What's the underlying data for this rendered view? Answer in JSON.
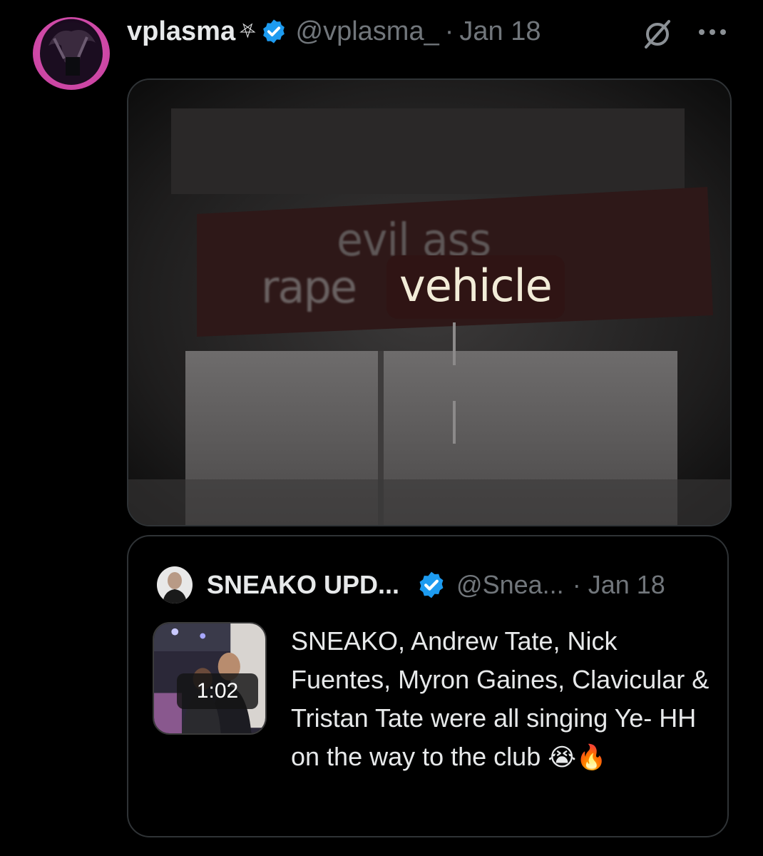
{
  "post": {
    "display_name": "vplasma",
    "name_symbol": "⛧",
    "handle": "@vplasma_",
    "separator": "·",
    "date": "Jan 18",
    "more": "···"
  },
  "media": {
    "caption_top": "evil ass",
    "caption_left": "rape",
    "caption_highlight": "vehicle"
  },
  "quote": {
    "display_name": "SNEAKO UPD...",
    "handle": "@Snea...",
    "separator": "·",
    "date": "Jan 18",
    "video_duration": "1:02",
    "text": "SNEAKO, Andrew Tate, Nick Fuentes, Myron Gaines, Clavicular & Tristan Tate were all singing Ye- HH on the way to the club",
    "emojis": "😭🔥"
  },
  "colors": {
    "background": "#000000",
    "text_primary": "#e7e9ea",
    "text_secondary": "#71767b",
    "verified_blue": "#1d9bf0",
    "border": "#2f3336"
  }
}
